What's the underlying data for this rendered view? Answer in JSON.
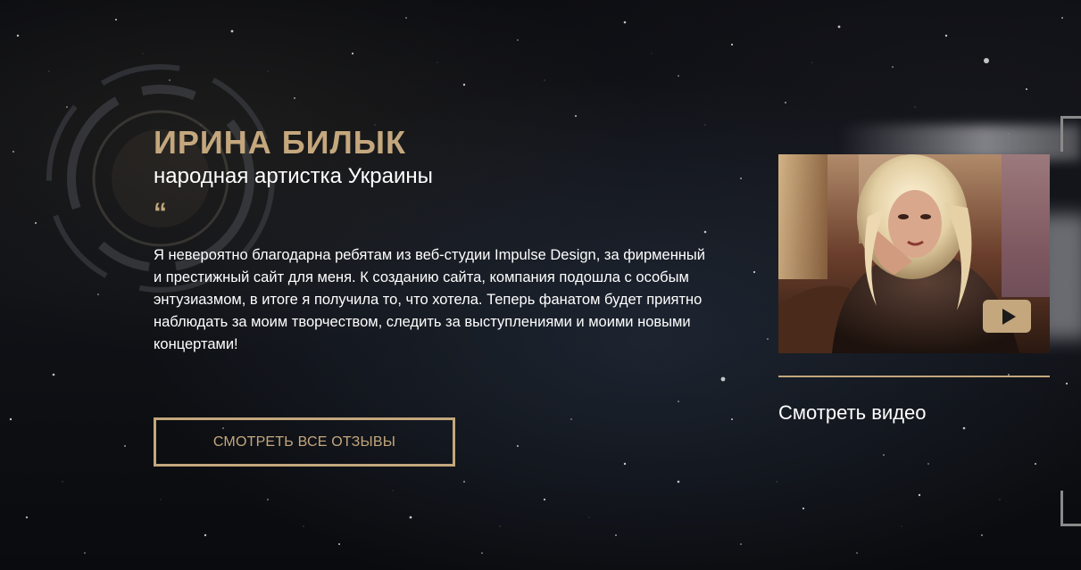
{
  "testimonial": {
    "name": "ИРИНА БИЛЫК",
    "title": "народная артистка Украины",
    "quote_mark": "“",
    "text": "Я невероятно благодарна ребятам из веб-студии Impulse Design, за фирменный и престижный сайт для меня. К созданию сайта, компания подошла с особым энтузиазмом, в итоге я получила то, что хотела. Теперь фанатом будет приятно наблюдать за моим творчеством, следить за выступлениями и моими новыми концертами!",
    "all_reviews_button": "СМОТРЕТЬ ВСЕ ОТЗЫВЫ"
  },
  "video": {
    "link_label": "Смотреть видео",
    "play_icon": "play-icon"
  },
  "colors": {
    "accent": "#c4a77d",
    "text": "#ffffff",
    "background": "#0b0c10"
  }
}
